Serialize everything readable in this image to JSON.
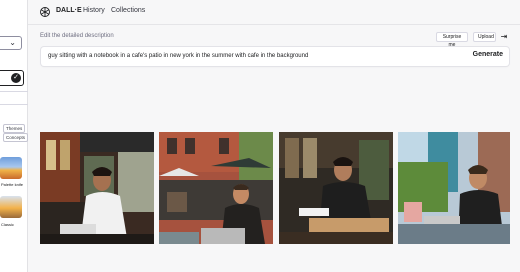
{
  "header": {
    "brand": "DALL·E",
    "nav": [
      "History",
      "Collections"
    ]
  },
  "prompt": {
    "label": "Edit the detailed description",
    "surprise_label": "Surprise me",
    "upload_label": "Upload",
    "text": "guy sitting with a notebook in a cafe's patio in new york in the summer with cafe in the background",
    "generate_label": "Generate"
  },
  "left_panel": {
    "tags": [
      "Themes",
      "Concepts"
    ],
    "captions": [
      "Palette knife",
      "Classic"
    ]
  },
  "icons": {
    "logo": "openai-logo-icon",
    "collapse": "collapse-panel-icon",
    "select": "chevron-down-icon",
    "check": "check-icon"
  },
  "results": [
    "generated-image-1",
    "generated-image-2",
    "generated-image-3",
    "generated-image-4"
  ]
}
